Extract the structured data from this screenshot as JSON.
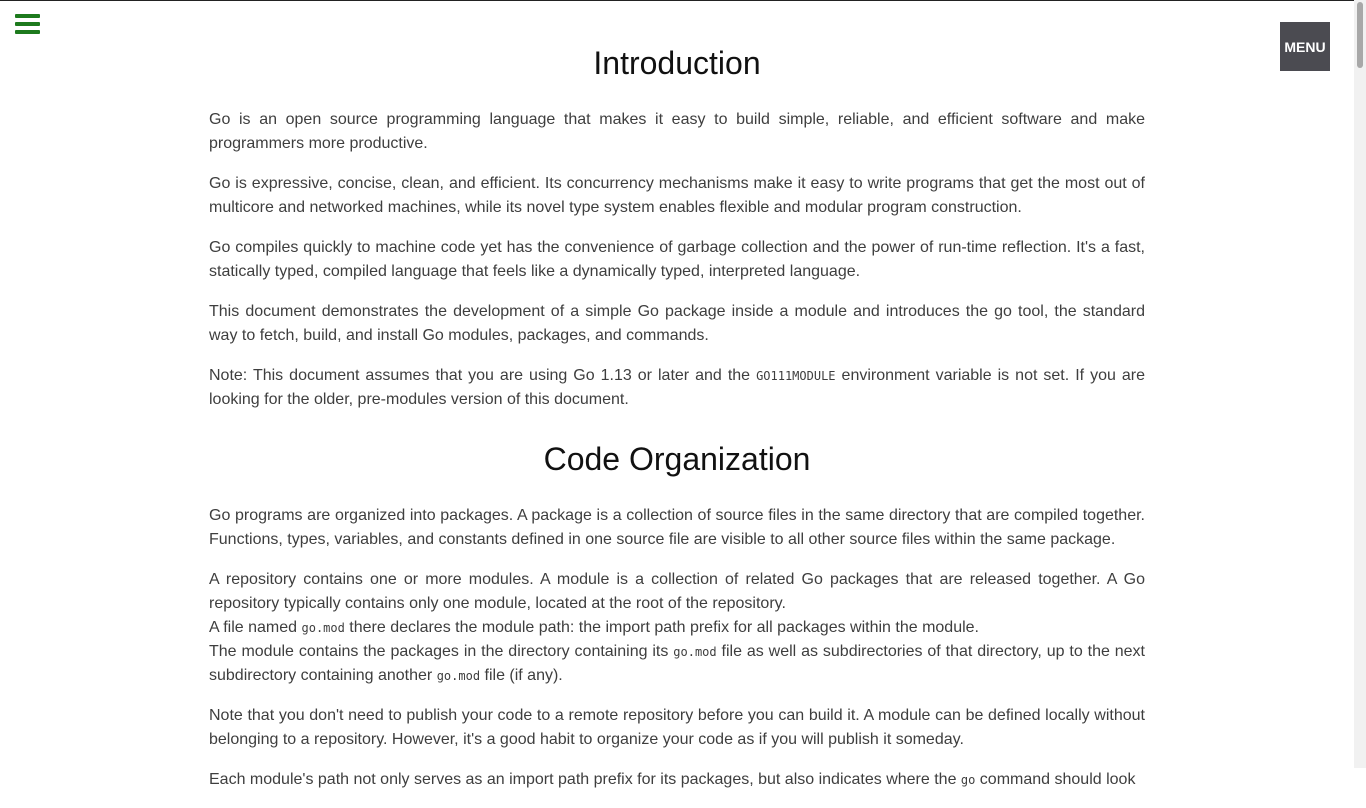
{
  "header": {
    "menu_label": "MENU"
  },
  "sections": [
    {
      "title": "Introduction",
      "paragraphs": [
        "Go is an open source programming language that makes it easy to build simple, reliable, and efficient software and make programmers more productive.",
        "Go is expressive, concise, clean, and efficient. Its concurrency mechanisms make it easy to write programs that get the most out of multicore and networked machines, while its novel type system enables flexible and modular program construction.",
        "Go compiles quickly to machine code yet has the convenience of garbage collection and the power of run-time reflection. It's a fast, statically typed, compiled language that feels like a dynamically typed, interpreted language.",
        "This document demonstrates the development of a simple Go package inside a module and introduces the go tool, the standard way to fetch, build, and install Go modules, packages, and commands."
      ],
      "note": {
        "before": "Note: This document assumes that you are using Go 1.13 or later and the ",
        "code": "GO111MODULE",
        "after": " environment variable is not set. If you are looking for the older, pre-modules version of this document."
      }
    },
    {
      "title": "Code Organization",
      "p1": "Go programs are organized into packages. A package is a collection of source files in the same directory that are compiled together. Functions, types, variables, and constants defined in one source file are visible to all other source files within the same package.",
      "p2": {
        "line1": "A repository contains one or more modules. A module is a collection of related Go packages that are released together. A Go repository typically contains only one module, located at the root of the repository.",
        "line2_before": "A file named ",
        "line2_code": "go.mod",
        "line2_after": " there declares the module path: the import path prefix for all packages within the module.",
        "line3_before": "The module contains the packages in the directory containing its ",
        "line3_code1": "go.mod",
        "line3_middle": " file as well as subdirectories of that directory, up to the next subdirectory containing another ",
        "line3_code2": "go.mod",
        "line3_after": " file (if any)."
      },
      "p3": "Note that you don't need to publish your code to a remote repository before you can build it. A module can be defined locally without belonging to a repository. However, it's a good habit to organize your code as if you will publish it someday.",
      "p4": {
        "before": "Each module's path not only serves as an import path prefix for its packages, but also indicates where the ",
        "code": "go",
        "after": " command should look"
      }
    }
  ]
}
